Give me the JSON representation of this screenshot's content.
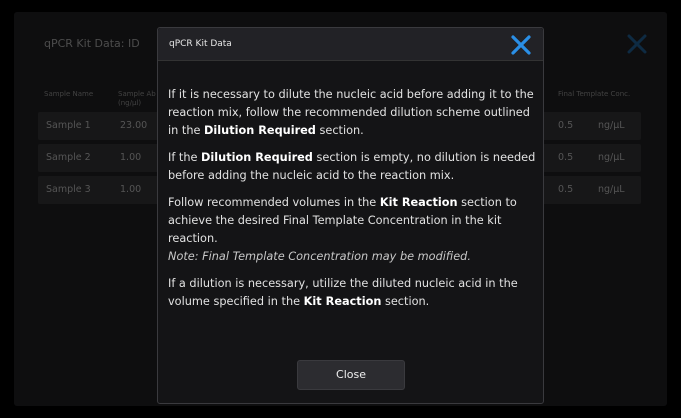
{
  "background": {
    "title": "qPCR Kit Data: ID",
    "table": {
      "headers": [
        "Sample Name",
        "Sample Ab Conc. (ng/µl)",
        "Final Template Conc."
      ],
      "rows": [
        {
          "name": "Sample 1",
          "conc": "23.00",
          "template": "0.5",
          "unit": "ng/µL"
        },
        {
          "name": "Sample 2",
          "conc": "1.00",
          "template": "0.5",
          "unit": "ng/µL"
        },
        {
          "name": "Sample 3",
          "conc": "1.00",
          "template": "0.5",
          "unit": "ng/µL"
        }
      ]
    }
  },
  "modal": {
    "title": "qPCR Kit Data",
    "p1_a": "If it is necessary to dilute the nucleic acid before adding it to the reaction mix, follow the recommended dilution scheme outlined in the ",
    "p1_b": "Dilution Required",
    "p1_c": " section.",
    "p2_a": "If the ",
    "p2_b": "Dilution Required",
    "p2_c": " section is empty, no dilution is needed before adding the nucleic acid to the reaction mix.",
    "p3_a": "Follow recommended volumes in the ",
    "p3_b": "Kit Reaction",
    "p3_c": " section to achieve the desired Final Template Concentration in the kit reaction.",
    "p3_note": "Note: Final Template Concentration may be modified.",
    "p4_a": "If a dilution is necessary, utilize the diluted nucleic acid in the volume specified in the ",
    "p4_b": "Kit Reaction",
    "p4_c": " section.",
    "close_label": "Close"
  },
  "colors": {
    "accent": "#2a8fe6"
  }
}
